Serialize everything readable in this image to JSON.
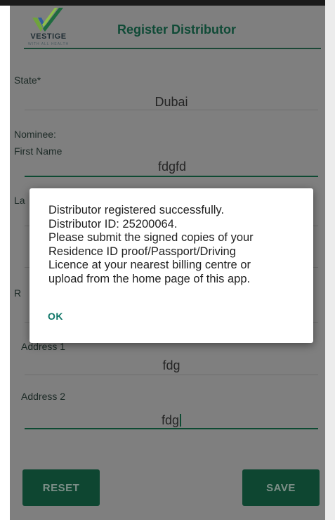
{
  "header": {
    "logo_text": "VESTIGE",
    "logo_tagline": "WITH ALL HEALTH",
    "title": "Register Distributor"
  },
  "form": {
    "state_label": "State*",
    "state_value": "Dubai",
    "nominee_label": "Nominee:",
    "first_name_label": "First Name",
    "first_name_value": "fdgfd",
    "last_name_label_partial": "La",
    "relation_label_partial": "R",
    "address1_label_partial": "Address 1",
    "address1_value": "fdg",
    "address2_label": "Address 2",
    "address2_value": "fdg"
  },
  "buttons": {
    "reset": "RESET",
    "save": "SAVE"
  },
  "dialog": {
    "lines": [
      "Distributor registered successfully.",
      "Distributor ID:  25200064.",
      "Please submit the signed copies of your",
      "Residence ID proof/Passport/Driving",
      "Licence at your nearest billing centre or",
      "upload from the home page of this app."
    ],
    "ok_label": "OK"
  },
  "colors": {
    "brand_green": "#0e4631",
    "dialog_action": "#0f7668",
    "scrim_background": "#7f7f7f"
  }
}
